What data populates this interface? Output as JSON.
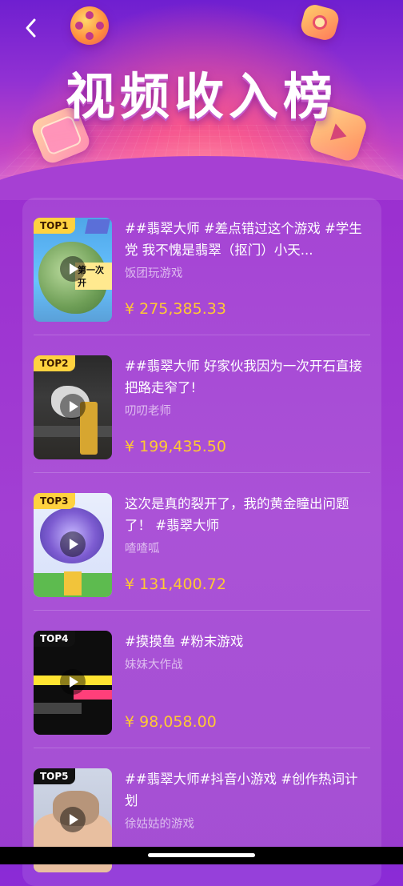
{
  "header": {
    "title": "视频收入榜"
  },
  "items": [
    {
      "rank": "TOP1",
      "title": "##翡翠大师 #差点错过这个游戏 #学生党 我不愧是翡翠（抠门）小天...",
      "author": "饭团玩游戏",
      "amount": "¥ 275,385.33",
      "thumb_caption": "第一次开"
    },
    {
      "rank": "TOP2",
      "title": "##翡翠大师 好家伙我因为一次开石直接把路走窄了!",
      "author": "叨叨老师",
      "amount": "¥ 199,435.50",
      "thumb_caption": ""
    },
    {
      "rank": "TOP3",
      "title": "这次是真的裂开了，我的黄金瞳出问题了！ #翡翠大师",
      "author": "喳喳呱",
      "amount": "¥ 131,400.72",
      "thumb_caption": ""
    },
    {
      "rank": "TOP4",
      "title": "#摸摸鱼 #粉末游戏",
      "author": "妹妹大作战",
      "amount": "¥ 98,058.00",
      "thumb_caption": ""
    },
    {
      "rank": "TOP5",
      "title": "##翡翠大师#抖音小游戏 #创作热词计划",
      "author": "徐姑姑的游戏",
      "amount": "",
      "thumb_caption": ""
    }
  ]
}
